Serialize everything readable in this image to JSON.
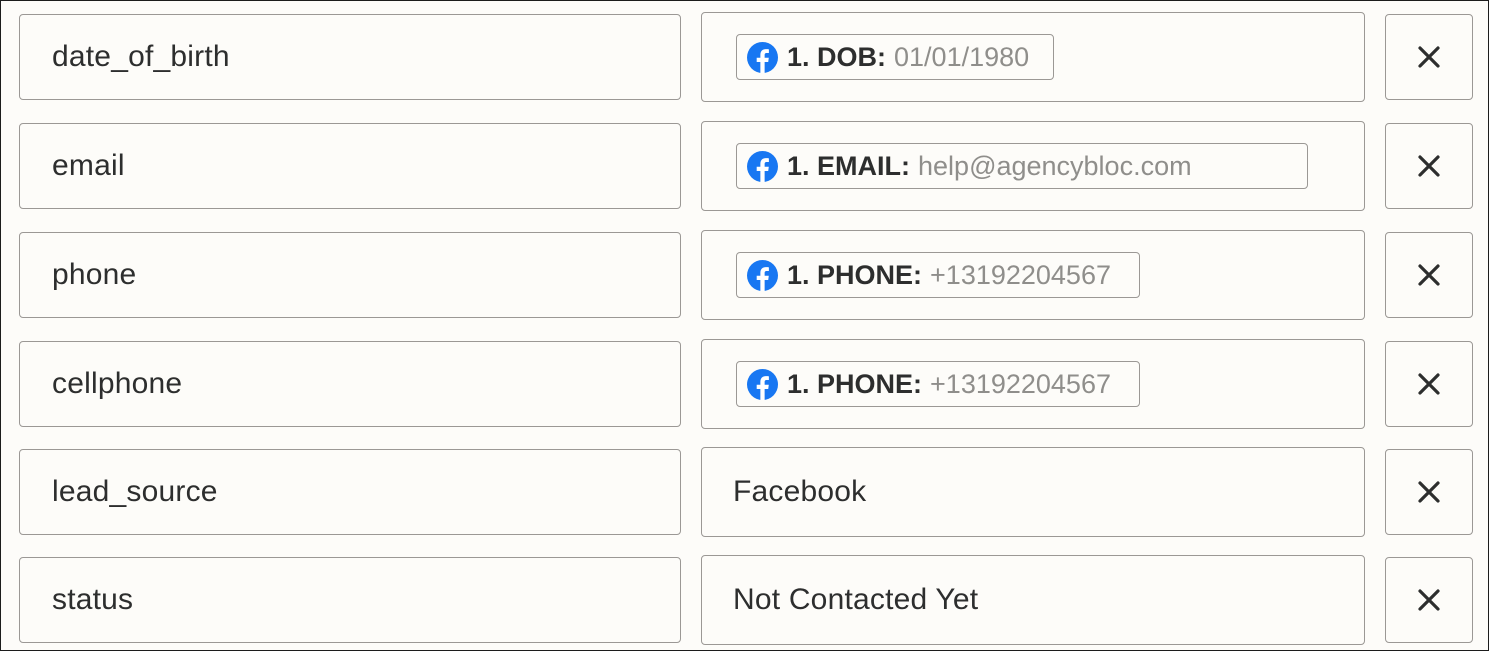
{
  "brand_colors": {
    "facebook": "#1877f2"
  },
  "rows": [
    {
      "field": "date_of_birth",
      "value_type": "mapped",
      "pill": {
        "icon": "facebook-icon",
        "key": "1. DOB:",
        "value": "01/01/1980"
      }
    },
    {
      "field": "email",
      "value_type": "mapped",
      "pill": {
        "icon": "facebook-icon",
        "key": "1. EMAIL:",
        "value": "help@agencybloc.com"
      }
    },
    {
      "field": "phone",
      "value_type": "mapped",
      "pill": {
        "icon": "facebook-icon",
        "key": "1. PHONE:",
        "value": "+13192204567"
      }
    },
    {
      "field": "cellphone",
      "value_type": "mapped",
      "pill": {
        "icon": "facebook-icon",
        "key": "1. PHONE:",
        "value": "+13192204567"
      }
    },
    {
      "field": "lead_source",
      "value_type": "text",
      "text": "Facebook"
    },
    {
      "field": "status",
      "value_type": "text",
      "text": "Not Contacted Yet"
    }
  ],
  "remove_icon": "close-icon"
}
